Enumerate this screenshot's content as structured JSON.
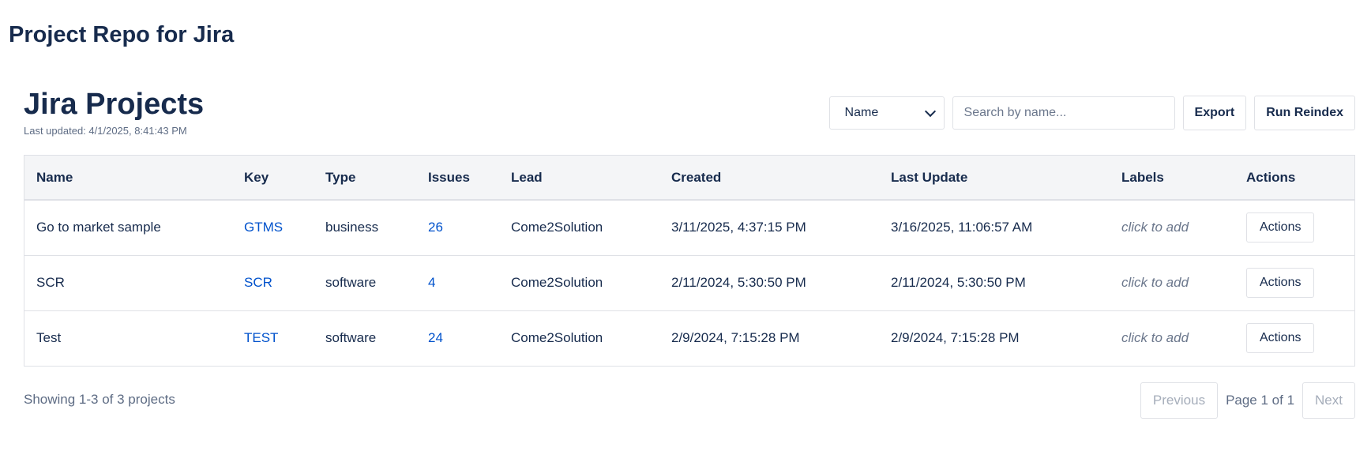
{
  "app": {
    "title": "Project Repo for Jira"
  },
  "header": {
    "title": "Jira Projects",
    "last_updated": "Last updated: 4/1/2025, 8:41:43 PM"
  },
  "toolbar": {
    "sort_select": {
      "selected": "Name",
      "options": [
        "Name"
      ]
    },
    "search": {
      "placeholder": "Search by name...",
      "value": ""
    },
    "export_label": "Export",
    "reindex_label": "Run Reindex"
  },
  "table": {
    "columns": [
      "Name",
      "Key",
      "Type",
      "Issues",
      "Lead",
      "Created",
      "Last Update",
      "Labels",
      "Actions"
    ],
    "rows": [
      {
        "name": "Go to market sample",
        "key": "GTMS",
        "type": "business",
        "issues": "26",
        "lead": "Come2Solution",
        "created": "3/11/2025, 4:37:15 PM",
        "last_update": "3/16/2025, 11:06:57 AM",
        "labels": "click to add",
        "actions": "Actions"
      },
      {
        "name": "SCR",
        "key": "SCR",
        "type": "software",
        "issues": "4",
        "lead": "Come2Solution",
        "created": "2/11/2024, 5:30:50 PM",
        "last_update": "2/11/2024, 5:30:50 PM",
        "labels": "click to add",
        "actions": "Actions"
      },
      {
        "name": "Test",
        "key": "TEST",
        "type": "software",
        "issues": "24",
        "lead": "Come2Solution",
        "created": "2/9/2024, 7:15:28 PM",
        "last_update": "2/9/2024, 7:15:28 PM",
        "labels": "click to add",
        "actions": "Actions"
      }
    ]
  },
  "footer": {
    "showing": "Showing 1-3 of 3 projects",
    "previous_label": "Previous",
    "page_info": "Page 1 of 1",
    "next_label": "Next"
  },
  "colors": {
    "text": "#172b4d",
    "link": "#0052cc",
    "muted": "#6b778c",
    "border": "#dfe1e6",
    "header_bg": "#f4f5f7"
  }
}
